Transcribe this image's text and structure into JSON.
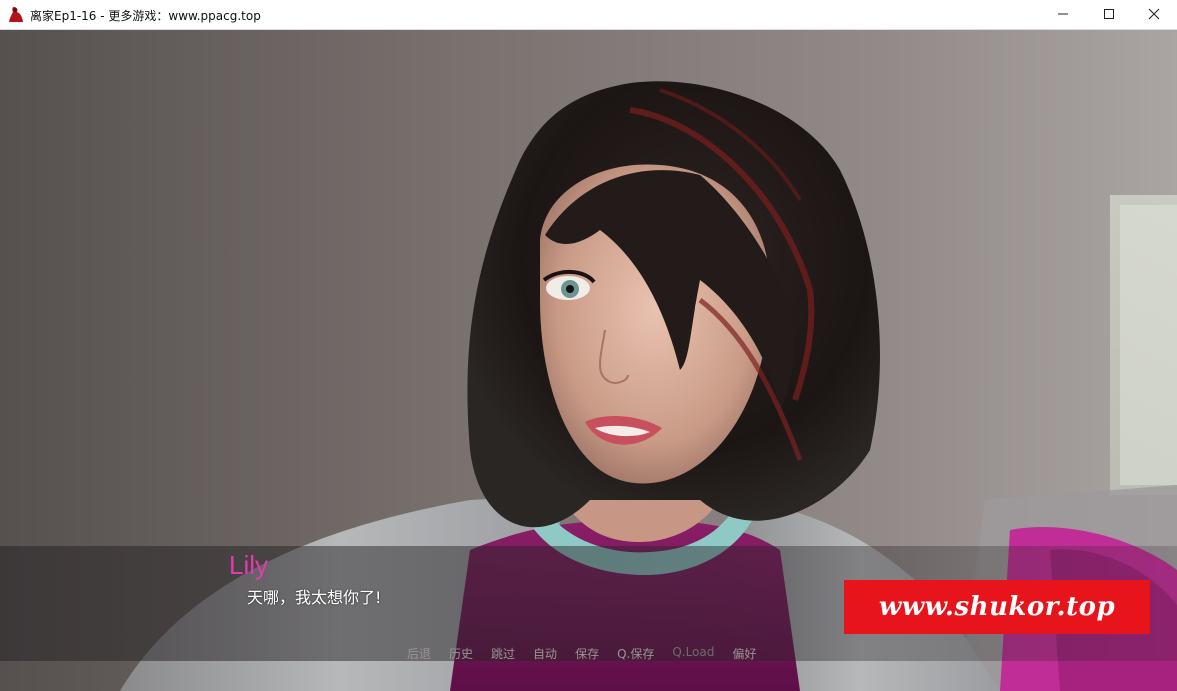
{
  "window": {
    "title": "离家Ep1-16 - 更多游戏：www.ppacg.top",
    "controls": {
      "minimize_icon": "minimize-icon",
      "maximize_icon": "maximize-icon",
      "close_icon": "close-icon"
    }
  },
  "dialogue": {
    "speaker": "Lily",
    "speaker_color": "#e23bb0",
    "text": "天哪，我太想你了!"
  },
  "quick_menu": {
    "items": [
      {
        "label": "后退",
        "enabled": true
      },
      {
        "label": "历史",
        "enabled": true
      },
      {
        "label": "跳过",
        "enabled": true
      },
      {
        "label": "自动",
        "enabled": true
      },
      {
        "label": "保存",
        "enabled": true
      },
      {
        "label": "Q.保存",
        "enabled": true
      },
      {
        "label": "Q.Load",
        "enabled": false
      },
      {
        "label": "偏好",
        "enabled": true
      }
    ]
  },
  "watermark": {
    "text": "www.shukor.top",
    "background": "#e8141c"
  },
  "colors": {
    "accent_name": "#e23bb0",
    "menu_text": "#9a9496"
  }
}
